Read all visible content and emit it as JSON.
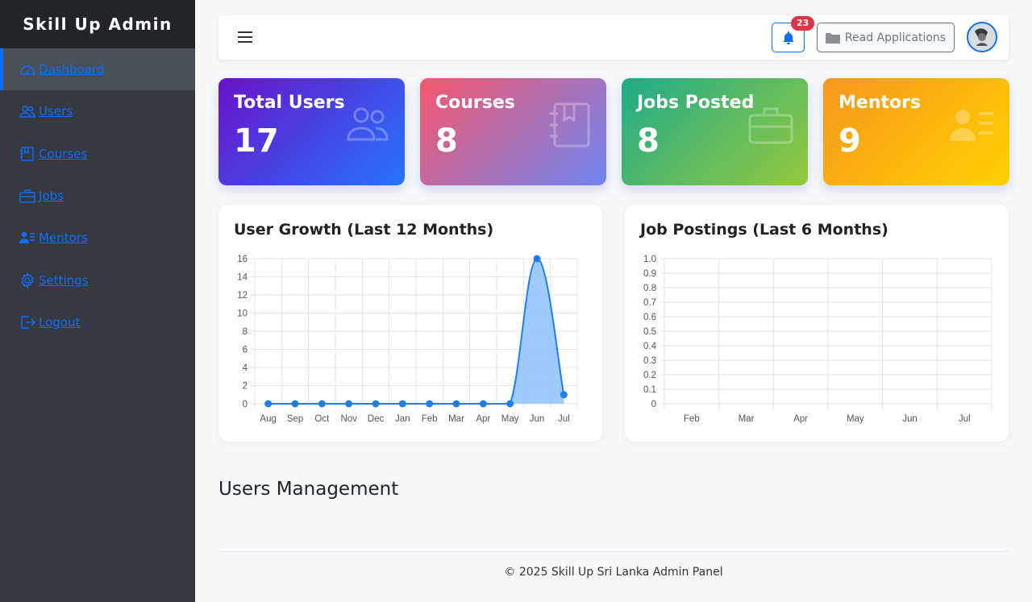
{
  "sidebar": {
    "brand": "Skill Up Admin",
    "items": [
      {
        "label": "Dashboard",
        "icon": "speedometer-icon"
      },
      {
        "label": "Users",
        "icon": "people-icon"
      },
      {
        "label": "Courses",
        "icon": "book-icon"
      },
      {
        "label": "Jobs",
        "icon": "briefcase-icon"
      },
      {
        "label": "Mentors",
        "icon": "person-lines-icon"
      },
      {
        "label": "Settings",
        "icon": "gear-icon"
      },
      {
        "label": "Logout",
        "icon": "logout-icon"
      }
    ]
  },
  "topbar": {
    "notification_count": "23",
    "read_applications_label": "Read Applications"
  },
  "stats": [
    {
      "label": "Total Users",
      "value": "17",
      "icon": "people-icon"
    },
    {
      "label": "Courses",
      "value": "8",
      "icon": "journal-icon"
    },
    {
      "label": "Jobs Posted",
      "value": "8",
      "icon": "briefcase-icon"
    },
    {
      "label": "Mentors",
      "value": "9",
      "icon": "person-lines-icon"
    }
  ],
  "chart_data": [
    {
      "type": "line",
      "title": "User Growth (Last 12 Months)",
      "categories": [
        "Aug",
        "Sep",
        "Oct",
        "Nov",
        "Dec",
        "Jan",
        "Feb",
        "Mar",
        "Apr",
        "May",
        "Jun",
        "Jul"
      ],
      "series": [
        {
          "values": [
            0,
            0,
            0,
            0,
            0,
            0,
            0,
            0,
            0,
            0,
            16,
            1
          ],
          "color": "#1e7ff5",
          "fill": "#8ec1fb"
        }
      ],
      "ylim": [
        0,
        16
      ],
      "yticks": [
        "0",
        "2",
        "4",
        "6",
        "8",
        "10",
        "12",
        "14",
        "16"
      ],
      "grid": true
    },
    {
      "type": "bar",
      "title": "Job Postings (Last 6 Months)",
      "categories": [
        "Feb",
        "Mar",
        "Apr",
        "May",
        "Jun",
        "Jul"
      ],
      "series": [
        {
          "values": [
            0,
            0,
            0,
            0,
            0,
            0
          ]
        }
      ],
      "ylim": [
        0,
        1
      ],
      "yticks": [
        "0",
        "0.1",
        "0.2",
        "0.3",
        "0.4",
        "0.5",
        "0.6",
        "0.7",
        "0.8",
        "0.9",
        "1.0"
      ],
      "grid": true
    }
  ],
  "users_section_title": "Users Management",
  "footer": "© 2025 Skill Up Sri Lanka Admin Panel"
}
